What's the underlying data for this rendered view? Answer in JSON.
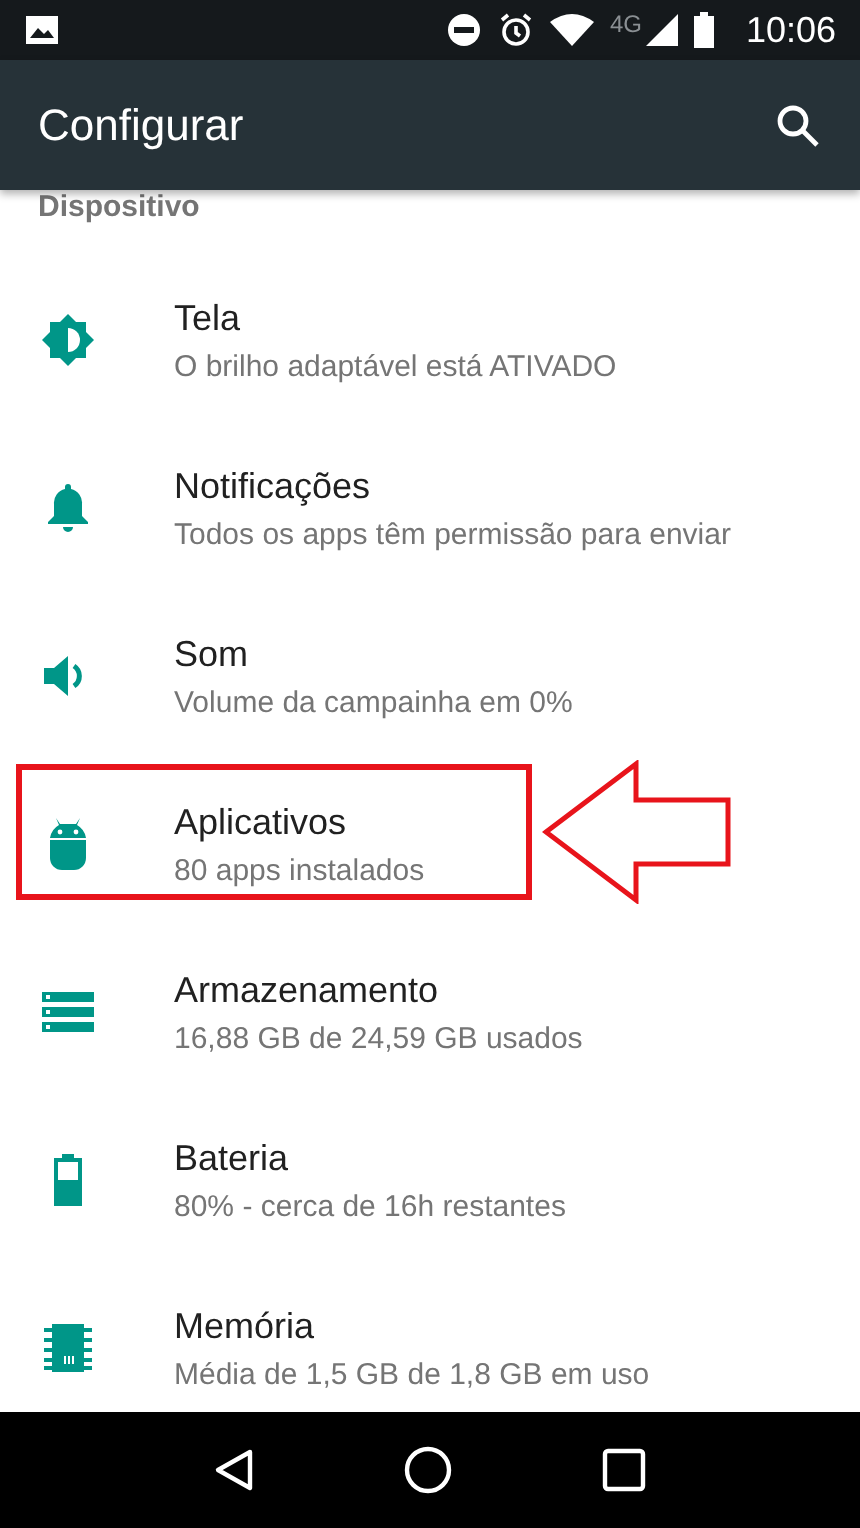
{
  "status_bar": {
    "network": "4G",
    "time": "10:06"
  },
  "toolbar": {
    "title": "Configurar"
  },
  "section": {
    "title": "Dispositivo"
  },
  "items": [
    {
      "kind": "brightness",
      "title": "Tela",
      "subtitle": "O brilho adaptável está ATIVADO",
      "highlighted": false
    },
    {
      "kind": "bell",
      "title": "Notificações",
      "subtitle": "Todos os apps têm permissão para enviar",
      "highlighted": false
    },
    {
      "kind": "volume",
      "title": "Som",
      "subtitle": "Volume da campainha em 0%",
      "highlighted": false
    },
    {
      "kind": "android",
      "title": "Aplicativos",
      "subtitle": "80 apps instalados",
      "highlighted": true
    },
    {
      "kind": "storage",
      "title": "Armazenamento",
      "subtitle": "16,88 GB de 24,59 GB usados",
      "highlighted": false
    },
    {
      "kind": "battery",
      "title": "Bateria",
      "subtitle": "80% - cerca de 16h restantes",
      "highlighted": false
    },
    {
      "kind": "memory",
      "title": "Memória",
      "subtitle": "Média de 1,5 GB de 1,8 GB em uso",
      "highlighted": false
    }
  ]
}
